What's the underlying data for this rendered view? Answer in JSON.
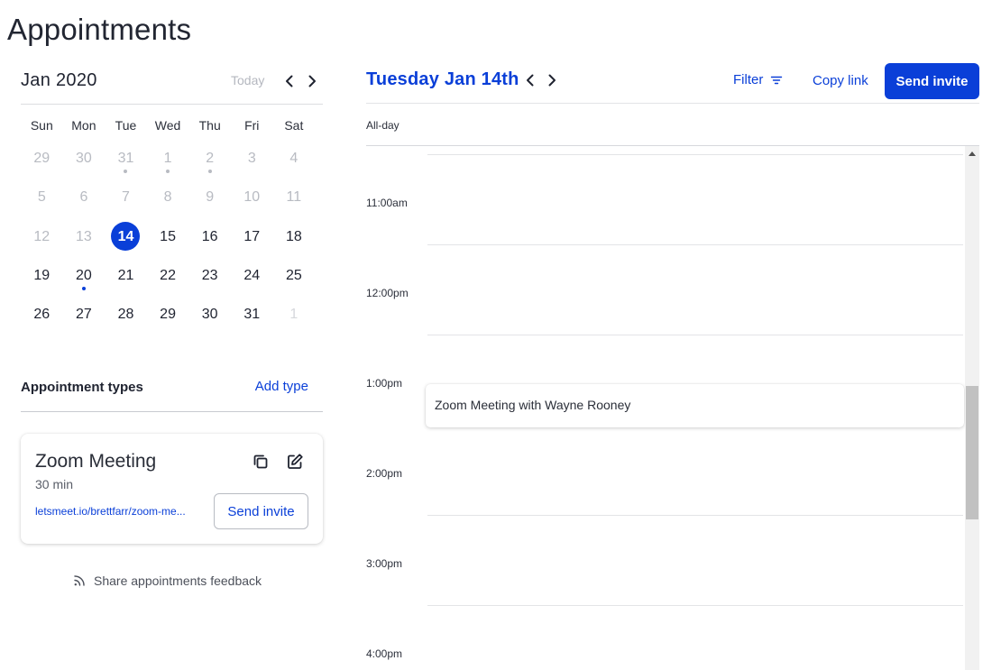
{
  "page": {
    "title": "Appointments"
  },
  "calendar": {
    "month_label": "Jan 2020",
    "today_label": "Today",
    "weekdays": [
      "Sun",
      "Mon",
      "Tue",
      "Wed",
      "Thu",
      "Fri",
      "Sat"
    ],
    "weeks": [
      [
        {
          "d": "29",
          "s": "muted"
        },
        {
          "d": "30",
          "s": "muted"
        },
        {
          "d": "31",
          "s": "muted",
          "dot": "gray"
        },
        {
          "d": "1",
          "s": "muted",
          "dot": "gray"
        },
        {
          "d": "2",
          "s": "muted",
          "dot": "gray"
        },
        {
          "d": "3",
          "s": "muted"
        },
        {
          "d": "4",
          "s": "muted"
        }
      ],
      [
        {
          "d": "5",
          "s": "muted"
        },
        {
          "d": "6",
          "s": "muted"
        },
        {
          "d": "7",
          "s": "muted"
        },
        {
          "d": "8",
          "s": "muted"
        },
        {
          "d": "9",
          "s": "muted"
        },
        {
          "d": "10",
          "s": "muted"
        },
        {
          "d": "11",
          "s": "muted"
        }
      ],
      [
        {
          "d": "12",
          "s": "muted"
        },
        {
          "d": "13",
          "s": "muted"
        },
        {
          "d": "14",
          "s": "selected"
        },
        {
          "d": "15",
          "s": "normal"
        },
        {
          "d": "16",
          "s": "normal"
        },
        {
          "d": "17",
          "s": "normal"
        },
        {
          "d": "18",
          "s": "normal"
        }
      ],
      [
        {
          "d": "19",
          "s": "normal"
        },
        {
          "d": "20",
          "s": "normal",
          "dot": "blue"
        },
        {
          "d": "21",
          "s": "normal"
        },
        {
          "d": "22",
          "s": "normal"
        },
        {
          "d": "23",
          "s": "normal"
        },
        {
          "d": "24",
          "s": "normal"
        },
        {
          "d": "25",
          "s": "normal"
        }
      ],
      [
        {
          "d": "26",
          "s": "normal"
        },
        {
          "d": "27",
          "s": "normal"
        },
        {
          "d": "28",
          "s": "normal"
        },
        {
          "d": "29",
          "s": "normal"
        },
        {
          "d": "30",
          "s": "normal"
        },
        {
          "d": "31",
          "s": "normal"
        },
        {
          "d": "1",
          "s": "dim"
        }
      ]
    ]
  },
  "appointment_types": {
    "title": "Appointment types",
    "add_label": "Add type",
    "items": [
      {
        "name": "Zoom Meeting",
        "duration": "30 min",
        "link": "letsmeet.io/brettfarr/zoom-me...",
        "send_label": "Send invite",
        "icons": [
          "copy-icon",
          "edit-icon"
        ]
      }
    ]
  },
  "feedback": {
    "label": "Share appointments feedback",
    "icon": "feed-icon"
  },
  "day_view": {
    "title": "Tuesday Jan 14th",
    "filter_label": "Filter",
    "copy_link_label": "Copy link",
    "send_invite_label": "Send invite",
    "allday_label": "All-day",
    "hours": [
      "11:00am",
      "12:00pm",
      "1:00pm",
      "2:00pm",
      "3:00pm",
      "4:00pm"
    ],
    "events": [
      {
        "title": "Zoom Meeting with Wayne Rooney"
      }
    ]
  },
  "colors": {
    "accent": "#0a3fd8",
    "muted_text": "#b8bbc2",
    "divider": "#e3e4e7"
  }
}
